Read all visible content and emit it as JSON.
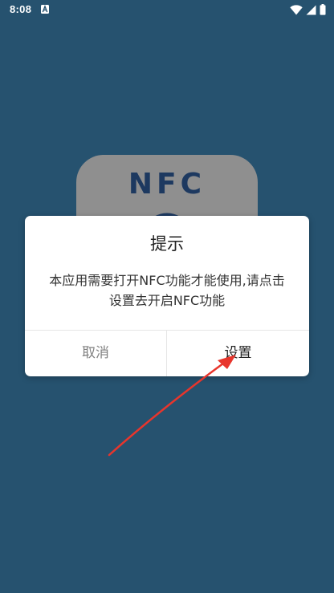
{
  "status_bar": {
    "time": "8:08",
    "notification_icon": "font-a-notification-icon",
    "icons": [
      "wifi-icon",
      "cellular-signal-icon",
      "battery-icon"
    ]
  },
  "background": {
    "color": "#26526f",
    "app_logo": {
      "text": "NFC",
      "icon": "nfc-waves-icon"
    }
  },
  "dialog": {
    "title": "提示",
    "message": "本应用需要打开NFC功能才能使用,请点击设置去开启NFC功能",
    "buttons": {
      "cancel_label": "取消",
      "settings_label": "设置"
    }
  },
  "annotation": {
    "arrow_icon": "red-arrow-pointer",
    "color": "#e8352c"
  }
}
